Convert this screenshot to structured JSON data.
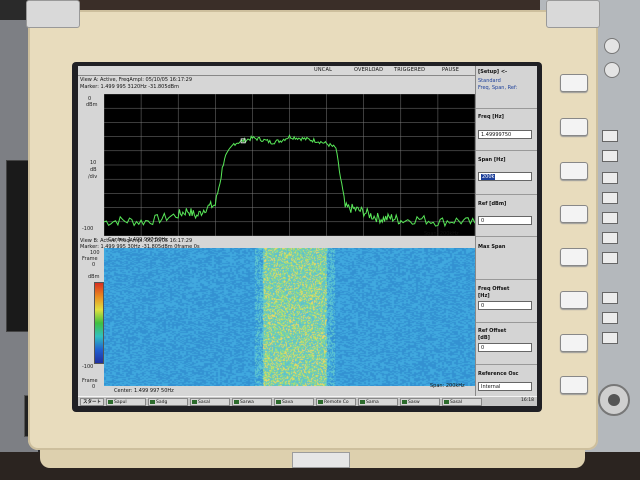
{
  "status_bar": {
    "items": [
      "UNCAL",
      "OVERLOAD",
      "TRIGGERED",
      "PAUSE"
    ]
  },
  "view_a": {
    "title": "View A: Active, FreqAmpl: 05/10/05 16:17:29",
    "marker": "Marker: 1.499 995 3120Hz  -31.805dBm",
    "y_unit_top": "dBm",
    "y_labels": [
      "0",
      "10",
      "dB",
      "/div",
      "-100"
    ],
    "center": "Center: 1.499 997 50Hz",
    "span": "Span: 200kHz"
  },
  "view_b": {
    "title": "View B: Active, FreqAmpl: 05/10/05 16:17:29",
    "marker": "Marker: 1.499 995 30Hz  -31.805dBm  0frame  0s",
    "y_labels": [
      "100",
      "Frame",
      "0",
      "dBm",
      "-100",
      "Frame",
      "0"
    ],
    "center": "Center: 1.499 997 50Hz",
    "span": "Span: 200kHz"
  },
  "side_panel": {
    "setup_header": "[Setup] <-",
    "setup_sub": "Standard",
    "setup_sub2": "Freq, Span, Ref:",
    "freq_label": "Freq [Hz]",
    "freq_value": "1.49999750",
    "span_label": "Span [Hz]",
    "span_value": "200k",
    "ref_label": "Ref [dBm]",
    "ref_value": "0",
    "max_span_label": "Max Span",
    "freq_offset_label": "Freq Offset",
    "freq_offset_unit": "[Hz]",
    "freq_offset_value": "0",
    "ref_offset_label": "Ref Offset",
    "ref_offset_unit": "[dB]",
    "ref_offset_value": "0",
    "ref_osc_label": "Reference Osc",
    "ref_osc_value": "Internal"
  },
  "taskbar": {
    "start_label": "スタート",
    "buttons": [
      "Sapul",
      "Sadg",
      "Sasal",
      "Sarwa",
      "Sava",
      "Remote Co",
      "Sama",
      "Sasw",
      "Sasal"
    ],
    "time": "16:18"
  },
  "chart_data": {
    "type": "line",
    "title": "",
    "xlabel": "",
    "ylabel": "dBm",
    "center_frequency": "1.499 997 50Hz",
    "span": "200kHz",
    "ylim": [
      -100,
      0
    ],
    "grid": true,
    "series": [
      {
        "x": [
          -100,
          -90,
          -80,
          -70,
          -60,
          -55,
          -50,
          -45,
          -40,
          -35,
          -30,
          -25,
          -20,
          -15,
          -10,
          -5,
          0,
          5,
          10,
          15,
          20,
          25,
          30,
          35,
          40,
          45,
          50,
          55,
          60,
          70,
          80,
          90,
          100
        ],
        "values": [
          -90,
          -89,
          -90,
          -88,
          -85,
          -82,
          -86,
          -80,
          -78,
          -45,
          -35,
          -33,
          -31,
          -32,
          -34,
          -33,
          -30,
          -31,
          -32,
          -33,
          -35,
          -38,
          -80,
          -81,
          -83,
          -86,
          -88,
          -87,
          -89,
          -88,
          -90,
          -89,
          -91
        ]
      }
    ]
  }
}
